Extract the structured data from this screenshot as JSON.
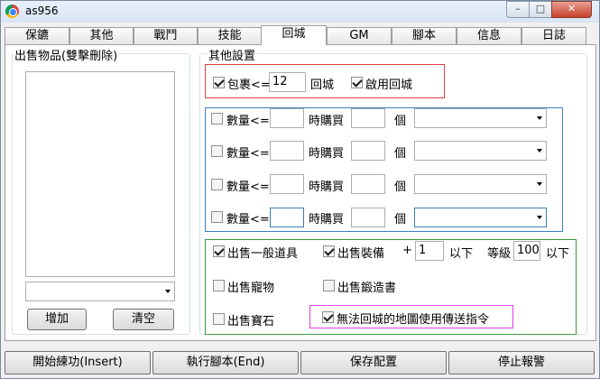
{
  "window": {
    "title": "as956",
    "min": "–",
    "max": "□",
    "close": "✕"
  },
  "tabs": [
    "保鑣",
    "其他",
    "戰鬥",
    "技能",
    "回城",
    "GM",
    "腳本",
    "信息",
    "日誌"
  ],
  "active_tab": "回城",
  "sell_items": {
    "title": "出售物品(雙擊刪除)",
    "combo_value": "",
    "add_label": "增加",
    "clear_label": "清空"
  },
  "other_settings": {
    "title": "其他設置",
    "bag": {
      "checked": true,
      "label": "包裹<=",
      "value": "12",
      "suffix": "回城"
    },
    "enable_return": {
      "checked": true,
      "label": "啟用回城"
    },
    "buy_rows": [
      {
        "checked": false,
        "label": "數量<=",
        "qty": "",
        "mid": "時購買",
        "count": "",
        "unit": "個",
        "item": ""
      },
      {
        "checked": false,
        "label": "數量<=",
        "qty": "",
        "mid": "時購買",
        "count": "",
        "unit": "個",
        "item": ""
      },
      {
        "checked": false,
        "label": "數量<=",
        "qty": "",
        "mid": "時購買",
        "count": "",
        "unit": "個",
        "item": ""
      },
      {
        "checked": false,
        "label": "數量<=",
        "qty": "",
        "mid": "時購買",
        "count": "",
        "unit": "個",
        "item": ""
      }
    ],
    "sell_general": {
      "checked": true,
      "label": "出售一般道具"
    },
    "sell_equip": {
      "checked": true,
      "label": "出售裝備",
      "plus": "+",
      "plus_value": "1",
      "below1": "以下",
      "level_label": "等級",
      "level_value": "100",
      "below2": "以下"
    },
    "sell_pet": {
      "checked": false,
      "label": "出售寵物"
    },
    "sell_forge": {
      "checked": false,
      "label": "出售鍛造書"
    },
    "sell_gem": {
      "checked": false,
      "label": "出售寶石"
    },
    "teleport": {
      "checked": true,
      "label": "無法回城的地圖使用傳送指令"
    }
  },
  "bottom": {
    "start": "開始練功(Insert)",
    "script": "執行腳本(End)",
    "save": "保存配置",
    "stop": "停止報警"
  }
}
